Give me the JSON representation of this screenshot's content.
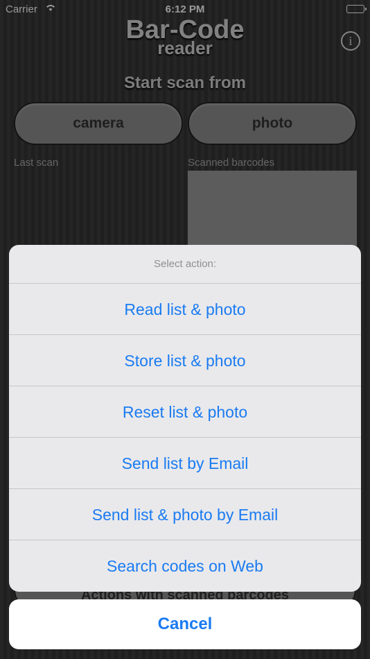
{
  "status_bar": {
    "carrier": "Carrier",
    "time": "6:12 PM"
  },
  "app": {
    "title_line1": "Bar-Code",
    "title_line2": "reader",
    "info_glyph": "i",
    "scan_heading": "Start scan from",
    "camera_label": "camera",
    "photo_label": "photo",
    "last_scan_label": "Last scan",
    "scanned_barcodes_label": "Scanned barcodes",
    "actions_label": "Actions with scanned barcodes"
  },
  "action_sheet": {
    "title": "Select action:",
    "actions": [
      "Read list & photo",
      "Store list & photo",
      "Reset list & photo",
      "Send list by Email",
      "Send list & photo by Email",
      "Search codes on Web"
    ],
    "cancel": "Cancel"
  },
  "colors": {
    "accent": "#1a7bf2",
    "button_gray": "#8e8e8e",
    "sheet_bg": "#e9e9eb"
  }
}
